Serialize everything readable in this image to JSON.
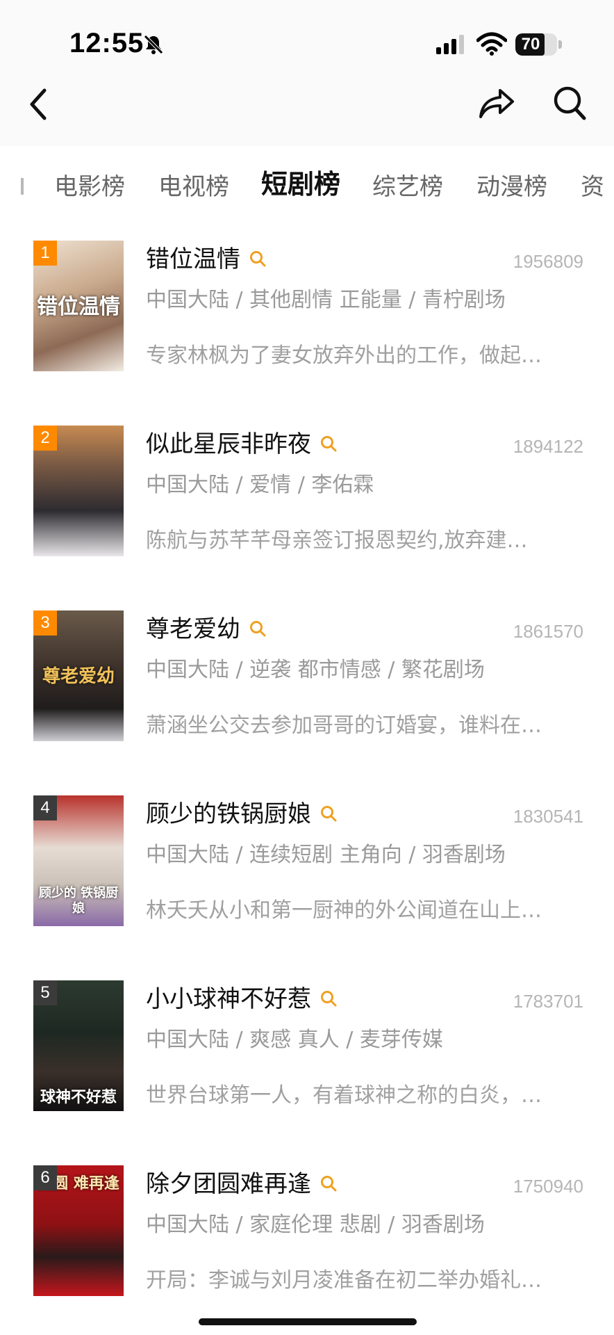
{
  "status_bar": {
    "time": "12:55",
    "battery": "70",
    "battery_level": 0.7
  },
  "tabs": [
    {
      "label": "电影榜",
      "active": false
    },
    {
      "label": "电视榜",
      "active": false
    },
    {
      "label": "短剧榜",
      "active": true
    },
    {
      "label": "综艺榜",
      "active": false
    },
    {
      "label": "动漫榜",
      "active": false
    }
  ],
  "tab_cut_label": "资",
  "colors": {
    "rank_top": "#ff8a00",
    "rank_other": "#3b3b3b",
    "search_icon": "#f0a020"
  },
  "items": [
    {
      "rank": "1",
      "title": "错位温情",
      "score": "1956809",
      "meta": "中国大陆 / 其他剧情 正能量 / 青柠剧场",
      "desc": "专家林枫为了妻女放弃外出的工作，做起…",
      "poster_text": "错位温情"
    },
    {
      "rank": "2",
      "title": "似此星辰非昨夜",
      "score": "1894122",
      "meta": "中国大陆 / 爱情 / 李佑霖",
      "desc": "陈航与苏芊芊母亲签订报恩契约,放弃建…"
    },
    {
      "rank": "3",
      "title": "尊老爱幼",
      "score": "1861570",
      "meta": "中国大陆 / 逆袭 都市情感 / 繁花剧场",
      "desc": "萧涵坐公交去参加哥哥的订婚宴，谁料在…",
      "poster_text": "尊老爱幼"
    },
    {
      "rank": "4",
      "title": "顾少的铁锅厨娘",
      "score": "1830541",
      "meta": "中国大陆 / 连续短剧 主角向 / 羽香剧场",
      "desc": "林夭夭从小和第一厨神的外公闻道在山上…",
      "poster_text": "顾少的 铁锅厨娘"
    },
    {
      "rank": "5",
      "title": "小小球神不好惹",
      "score": "1783701",
      "meta": "中国大陆 / 爽感 真人 / 麦芽传媒",
      "desc": "世界台球第一人，有着球神之称的白炎，…",
      "poster_text": "球神不好惹"
    },
    {
      "rank": "6",
      "title": "除夕团圆难再逢",
      "score": "1750940",
      "meta": "中国大陆 / 家庭伦理 悲剧 / 羽香剧场",
      "desc": "开局：李诚与刘月凌准备在初二举办婚礼…",
      "poster_text": "团圆 难再逢"
    }
  ]
}
